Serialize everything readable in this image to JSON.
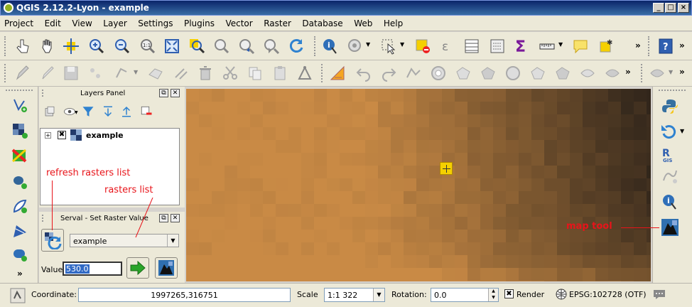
{
  "window": {
    "title": "QGIS 2.12.2-Lyon - example"
  },
  "menubar": {
    "items": [
      "Project",
      "Edit",
      "View",
      "Layer",
      "Settings",
      "Plugins",
      "Vector",
      "Raster",
      "Database",
      "Web",
      "Help"
    ]
  },
  "layers_panel": {
    "title": "Layers Panel",
    "layer_name": "example"
  },
  "serval_panel": {
    "title": "Serval - Set Raster Value",
    "raster_selected": "example",
    "value_label": "Value",
    "value": "530.0"
  },
  "annotations": {
    "refresh": "refresh rasters list",
    "rasters_list": "rasters list",
    "map_tool": "map tool"
  },
  "statusbar": {
    "coordinate_label": "Coordinate:",
    "coordinate_value": "1997265,316751",
    "scale_label": "Scale",
    "scale_value": "1:1 322",
    "rotation_label": "Rotation:",
    "rotation_value": "0.0",
    "render_label": "Render",
    "crs": "EPSG:102728 (OTF)"
  },
  "colors": {
    "title_bar": "#0a246a",
    "annotation_red": "#e8141a",
    "raster_light": "#c98a45",
    "raster_dark": "#2a2119"
  }
}
